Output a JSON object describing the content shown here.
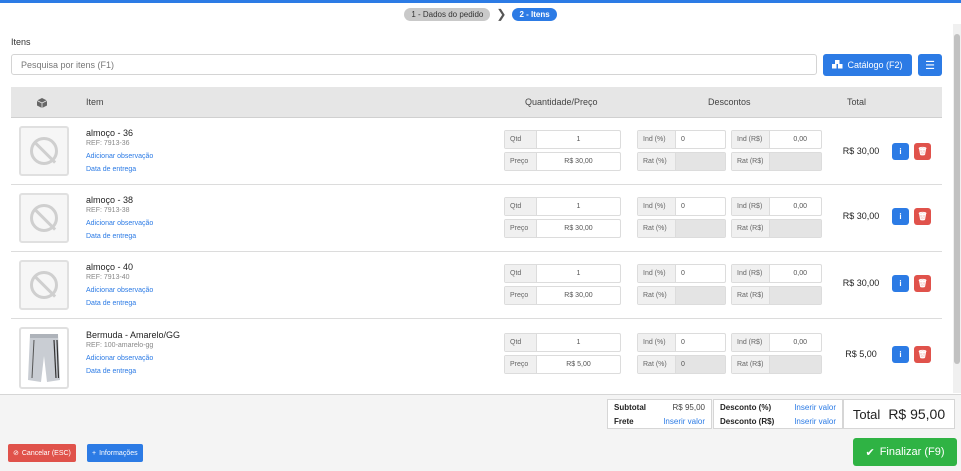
{
  "steps": [
    {
      "label": "1 - Dados do pedido"
    },
    {
      "label": "2 - Itens"
    }
  ],
  "section_title": "Itens",
  "search": {
    "placeholder": "Pesquisa por itens (F1)"
  },
  "catalog_button": "Catálogo (F2)",
  "menu_icon": "bars-icon",
  "table": {
    "headers": {
      "icon": "box-icon",
      "item": "Item",
      "qty_price": "Quantidade/Preço",
      "discounts": "Descontos",
      "total": "Total"
    },
    "labels": {
      "qtd": "Qtd",
      "preco": "Preço",
      "ind_pct": "Ind (%)",
      "rat_pct": "Rat (%)",
      "ind_rs": "Ind (R$)",
      "rat_rs": "Rat (R$)",
      "add_obs": "Adicionar observação",
      "delivery": "Data de entrega"
    },
    "rows": [
      {
        "name": "almoço - 36",
        "ref": "REF: 7913-36",
        "qtd": "1",
        "preco": "R$ 30,00",
        "ind_pct": "0",
        "rat_pct": "",
        "ind_rs": "0,00",
        "rat_rs": "",
        "total": "R$ 30,00",
        "image": "no-image-icon"
      },
      {
        "name": "almoço - 38",
        "ref": "REF: 7913-38",
        "qtd": "1",
        "preco": "R$ 30,00",
        "ind_pct": "0",
        "rat_pct": "",
        "ind_rs": "0,00",
        "rat_rs": "",
        "total": "R$ 30,00",
        "image": "no-image-icon"
      },
      {
        "name": "almoço - 40",
        "ref": "REF: 7913-40",
        "qtd": "1",
        "preco": "R$ 30,00",
        "ind_pct": "0",
        "rat_pct": "",
        "ind_rs": "0,00",
        "rat_rs": "",
        "total": "R$ 30,00",
        "image": "no-image-icon"
      },
      {
        "name": "Bermuda - Amarelo/GG",
        "ref": "REF: 100-amarelo-gg",
        "qtd": "1",
        "preco": "R$ 5,00",
        "ind_pct": "0",
        "rat_pct": "0",
        "ind_rs": "0,00",
        "rat_rs": "",
        "total": "R$ 5,00",
        "image": "shorts-photo"
      }
    ]
  },
  "summary": {
    "subtotal_label": "Subtotal",
    "subtotal_value": "R$ 95,00",
    "frete_label": "Frete",
    "frete_value": "Inserir valor",
    "desc_pct_label": "Desconto (%)",
    "desc_pct_value": "Inserir valor",
    "desc_rs_label": "Desconto (R$)",
    "desc_rs_value": "Inserir valor",
    "total_label": "Total",
    "total_value": "R$ 95,00"
  },
  "buttons": {
    "cancel": "Cancelar (ESC)",
    "info": "Informações",
    "finalize": "Finalizar (F9)"
  },
  "colors": {
    "primary": "#2c7be5",
    "danger": "#e0524b",
    "success": "#2fb344"
  }
}
